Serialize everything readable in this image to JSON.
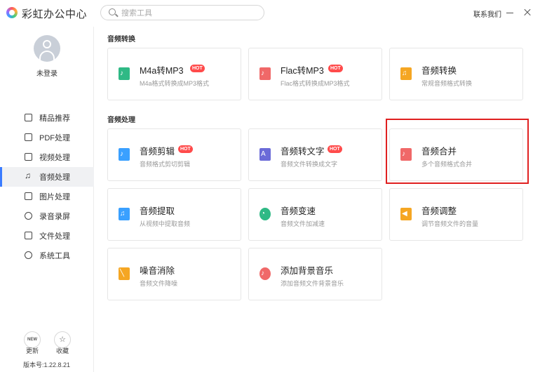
{
  "app": {
    "title": "彩虹办公中心"
  },
  "search": {
    "placeholder": "搜索工具"
  },
  "header": {
    "contact": "联系我们"
  },
  "user": {
    "login": "未登录"
  },
  "sidebar": {
    "items": [
      {
        "label": "精品推荐",
        "icon": "thumbs-up-icon"
      },
      {
        "label": "PDF处理",
        "icon": "pdf-icon"
      },
      {
        "label": "视频处理",
        "icon": "video-icon"
      },
      {
        "label": "音频处理",
        "icon": "music-icon",
        "active": true
      },
      {
        "label": "图片处理",
        "icon": "image-icon"
      },
      {
        "label": "录音录屏",
        "icon": "record-icon"
      },
      {
        "label": "文件处理",
        "icon": "folder-icon"
      },
      {
        "label": "系统工具",
        "icon": "monitor-icon"
      }
    ],
    "update_label": "更新",
    "update_badge": "NEW",
    "favorite_label": "收藏",
    "version": "版本号:1.22.8.21"
  },
  "sections": [
    {
      "title": "音频转换",
      "cards": [
        {
          "title": "M4a转MP3",
          "desc": "M4a格式转换成MP3格式",
          "hot": "HOT",
          "icon": "m4a-mp3-icon",
          "color": "#2fb985"
        },
        {
          "title": "Flac转MP3",
          "desc": "Flac格式转换成MP3格式",
          "hot": "HOT",
          "icon": "flac-mp3-icon",
          "color": "#f06868"
        },
        {
          "title": "音频转换",
          "desc": "常规音频格式转换",
          "icon": "audio-convert-icon",
          "color": "#f5a623"
        }
      ]
    },
    {
      "title": "音频处理",
      "cards": [
        {
          "title": "音频剪辑",
          "desc": "音频格式剪切剪辑",
          "hot": "HOT",
          "icon": "audio-cut-icon",
          "color": "#3aa0ff"
        },
        {
          "title": "音频转文字",
          "desc": "音频文件转换成文字",
          "hot": "HOT",
          "icon": "audio-to-text-icon",
          "color": "#6b6bd8"
        },
        {
          "title": "音频合并",
          "desc": "多个音频格式合并",
          "icon": "audio-merge-icon",
          "color": "#f06868"
        },
        {
          "title": "音频提取",
          "desc": "从视频中提取音频",
          "icon": "audio-extract-icon",
          "color": "#3aa0ff"
        },
        {
          "title": "音频变速",
          "desc": "音频文件加减速",
          "icon": "audio-speed-icon",
          "color": "#2fb985"
        },
        {
          "title": "音频调整",
          "desc": "调节音频文件的音量",
          "icon": "volume-icon",
          "color": "#f5a623"
        },
        {
          "title": "噪音消除",
          "desc": "音频文件降噪",
          "icon": "noise-off-icon",
          "color": "#f5a623"
        },
        {
          "title": "添加背景音乐",
          "desc": "添加音频文件背景音乐",
          "icon": "bg-music-icon",
          "color": "#f06868"
        }
      ]
    }
  ]
}
